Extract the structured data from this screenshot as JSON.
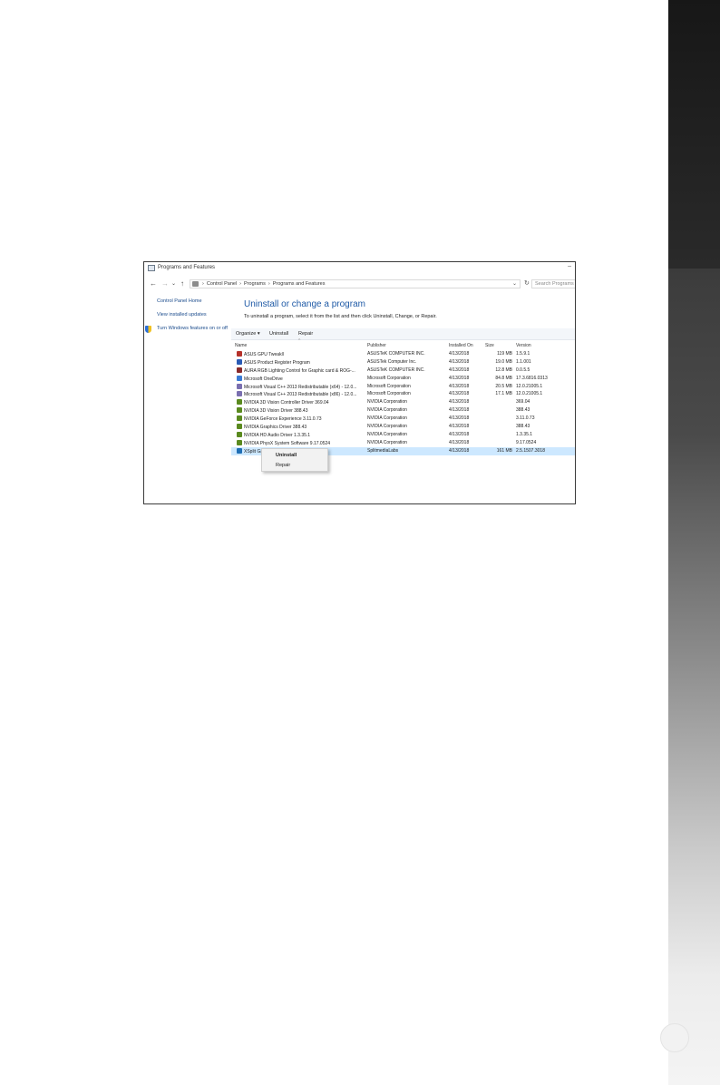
{
  "window": {
    "title": "Programs and Features",
    "minimize_glyph": "–"
  },
  "address_bar": {
    "back_glyph": "←",
    "forward_glyph": "→",
    "recent_glyph": "⌄",
    "up_glyph": "↑",
    "crumbs": [
      "›",
      "Control Panel",
      "›",
      "Programs",
      "›",
      "Programs and Features"
    ],
    "dropdown_glyph": "⌄",
    "refresh_glyph": "↻",
    "search_placeholder": "Search Programs and Features"
  },
  "left_pane": {
    "home": "Control Panel Home",
    "updates": "View installed updates",
    "features": "Turn Windows features on or off"
  },
  "main": {
    "title": "Uninstall or change a program",
    "subtitle": "To uninstall a program, select it from the list and then click Uninstall, Change, or Repair."
  },
  "toolbar": {
    "organize": "Organize ▾",
    "uninstall": "Uninstall",
    "repair": "Repair"
  },
  "sort_caret": "^",
  "columns": {
    "name": "Name",
    "publisher": "Publisher",
    "installed_on": "Installed On",
    "size": "Size",
    "version": "Version"
  },
  "programs": [
    {
      "name": "ASUS GPU Tweakll",
      "publisher": "ASUSTeK COMPUTER INC.",
      "installed": "4/13/2018",
      "size": "119 MB",
      "version": "1.5.9.1",
      "icon": "asus-gpu-tweak-icon",
      "icon_color": "#b5312a"
    },
    {
      "name": "ASUS Product Register Program",
      "publisher": "ASUSTek Computer Inc.",
      "installed": "4/13/2018",
      "size": "19.0 MB",
      "version": "1.1.001",
      "icon": "asus-register-icon",
      "icon_color": "#2a5bb5"
    },
    {
      "name": "AURA RGB Lighting Control for Graphic card & ROG-...",
      "publisher": "ASUSTeK COMPUTER INC.",
      "installed": "4/13/2018",
      "size": "12.8 MB",
      "version": "0.0.5.5",
      "icon": "aura-icon",
      "icon_color": "#8a2a2a"
    },
    {
      "name": "Microsoft OneDrive",
      "publisher": "Microsoft Corporation",
      "installed": "4/13/2018",
      "size": "84.8 MB",
      "version": "17.3.6816.0313",
      "icon": "onedrive-icon",
      "icon_color": "#3a7bd5"
    },
    {
      "name": "Microsoft Visual C++ 2013 Redistributable (x64) - 12.0...",
      "publisher": "Microsoft Corporation",
      "installed": "4/13/2018",
      "size": "20.5 MB",
      "version": "12.0.21005.1",
      "icon": "vc-redist-icon",
      "icon_color": "#7a6fb0"
    },
    {
      "name": "Microsoft Visual C++ 2013 Redistributable (x86) - 12.0...",
      "publisher": "Microsoft Corporation",
      "installed": "4/13/2018",
      "size": "17.1 MB",
      "version": "12.0.21005.1",
      "icon": "vc-redist-icon",
      "icon_color": "#7a6fb0"
    },
    {
      "name": "NVIDIA 3D Vision Controller Driver 369.04",
      "publisher": "NVIDIA Corporation",
      "installed": "4/13/2018",
      "size": "",
      "version": "369.04",
      "icon": "nvidia-icon",
      "icon_color": "#5a8a1f"
    },
    {
      "name": "NVIDIA 3D Vision Driver 388.43",
      "publisher": "NVIDIA Corporation",
      "installed": "4/13/2018",
      "size": "",
      "version": "388.43",
      "icon": "nvidia-icon",
      "icon_color": "#5a8a1f"
    },
    {
      "name": "NVIDIA GeForce Experience 3.11.0.73",
      "publisher": "NVIDIA Corporation",
      "installed": "4/13/2018",
      "size": "",
      "version": "3.11.0.73",
      "icon": "nvidia-icon",
      "icon_color": "#5a8a1f"
    },
    {
      "name": "NVIDIA Graphics Driver 388.43",
      "publisher": "NVIDIA Corporation",
      "installed": "4/13/2018",
      "size": "",
      "version": "388.43",
      "icon": "nvidia-icon",
      "icon_color": "#5a8a1f"
    },
    {
      "name": "NVIDIA HD Audio Driver 1.3.35.1",
      "publisher": "NVIDIA Corporation",
      "installed": "4/13/2018",
      "size": "",
      "version": "1.3.35.1",
      "icon": "nvidia-icon",
      "icon_color": "#5a8a1f"
    },
    {
      "name": "NVIDIA PhysX System Software 9.17.0524",
      "publisher": "NVIDIA Corporation",
      "installed": "4/13/2018",
      "size": "",
      "version": "9.17.0524",
      "icon": "nvidia-icon",
      "icon_color": "#5a8a1f"
    },
    {
      "name": "XSplit Ga",
      "publisher": "SplitmediaLabs",
      "installed": "4/13/2018",
      "size": "161 MB",
      "version": "2.5.1507.3018",
      "icon": "xsplit-icon",
      "icon_color": "#1f6fb5",
      "selected": true
    }
  ],
  "context_menu": {
    "uninstall": "Uninstall",
    "repair": "Repair"
  },
  "colors": {
    "link": "#1a4b8c",
    "title": "#1f5aa6",
    "selection": "#cde8ff"
  }
}
